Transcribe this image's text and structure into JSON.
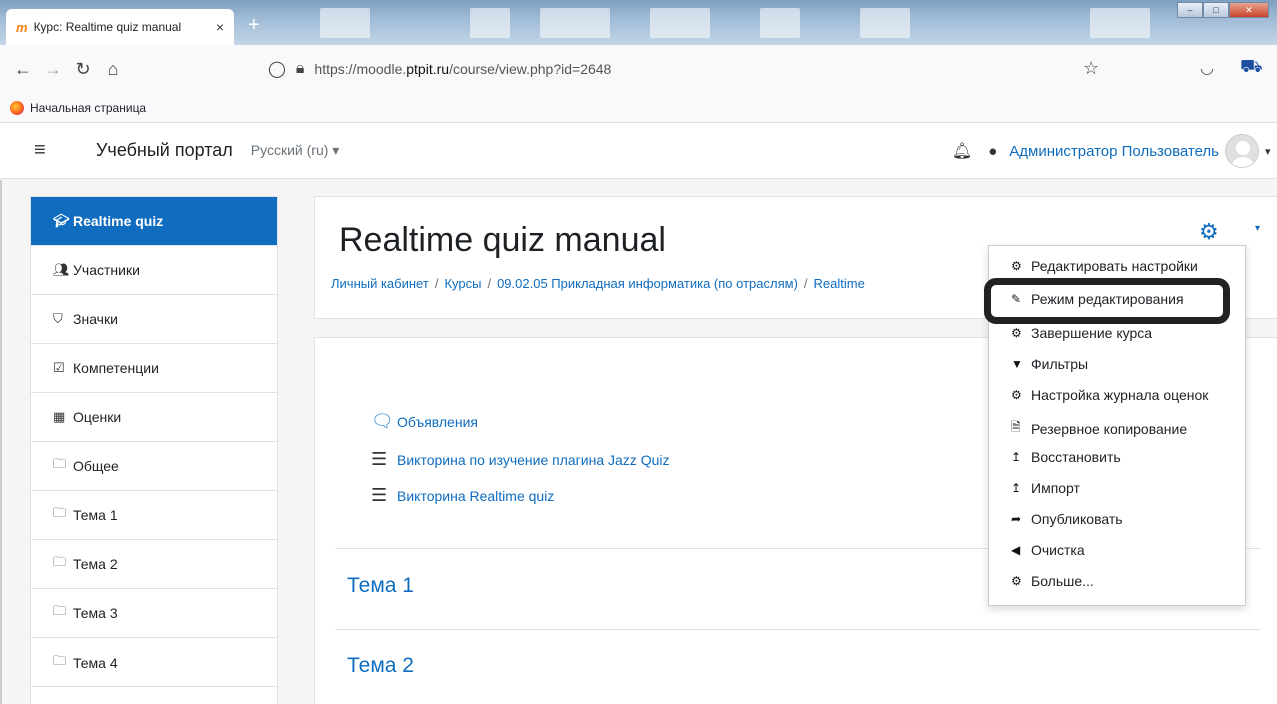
{
  "browser": {
    "tab_title": "Курс: Realtime quiz manual",
    "tab_close": "×",
    "new_tab": "+",
    "url_host_pre": "https://moodle.",
    "url_host_bold": "ptpit.ru",
    "url_path": "/course/view.php?id=2648",
    "bookmark": "Начальная страница"
  },
  "header": {
    "site_name": "Учебный портал",
    "language": "Русский (ru) ▾",
    "user_name": "Администратор Пользователь"
  },
  "sidebar": {
    "items": [
      {
        "label": "Realtime quiz",
        "icon": "graduation-cap-icon",
        "active": true
      },
      {
        "label": "Участники",
        "icon": "users-icon"
      },
      {
        "label": "Значки",
        "icon": "shield-icon"
      },
      {
        "label": "Компетенции",
        "icon": "check-square-icon"
      },
      {
        "label": "Оценки",
        "icon": "table-icon"
      },
      {
        "label": "Общее",
        "icon": "folder-icon"
      },
      {
        "label": "Тема 1",
        "icon": "folder-icon"
      },
      {
        "label": "Тема 2",
        "icon": "folder-icon"
      },
      {
        "label": "Тема 3",
        "icon": "folder-icon"
      },
      {
        "label": "Тема 4",
        "icon": "folder-icon"
      }
    ]
  },
  "page": {
    "title": "Realtime quiz manual",
    "breadcrumbs": [
      "Личный кабинет",
      "Курсы",
      "09.02.05 Прикладная информатика (по отраслям)",
      "Realtime"
    ]
  },
  "course": {
    "activities": [
      {
        "label": "Объявления",
        "icon": "forum-icon"
      },
      {
        "label": "Викторина по изучение плагина Jazz Quiz",
        "icon": "quiz-list-icon"
      },
      {
        "label": "Викторина Realtime quiz",
        "icon": "quiz-list-icon"
      }
    ],
    "sections": [
      "Тема 1",
      "Тема 2"
    ]
  },
  "menu": {
    "items": [
      {
        "label": "Редактировать настройки",
        "icon": "cog-icon"
      },
      {
        "label": "Режим редактирования",
        "icon": "pencil-icon",
        "highlighted": true
      },
      {
        "label": "Завершение курса",
        "icon": "cog-icon"
      },
      {
        "label": "Фильтры",
        "icon": "filter-icon"
      },
      {
        "label": "Настройка журнала оценок",
        "icon": "cog-icon"
      },
      {
        "label": "Резервное копирование",
        "icon": "file-archive-icon"
      },
      {
        "label": "Восстановить",
        "icon": "level-up-icon"
      },
      {
        "label": "Импорт",
        "icon": "level-up-icon"
      },
      {
        "label": "Опубликовать",
        "icon": "share-icon"
      },
      {
        "label": "Очистка",
        "icon": "arrow-left-icon"
      },
      {
        "label": "Больше...",
        "icon": "cog-icon"
      }
    ]
  },
  "colors": {
    "accent": "#0f6cbf",
    "active_bg": "#0f6cbf",
    "highlight_border": "#222222"
  }
}
